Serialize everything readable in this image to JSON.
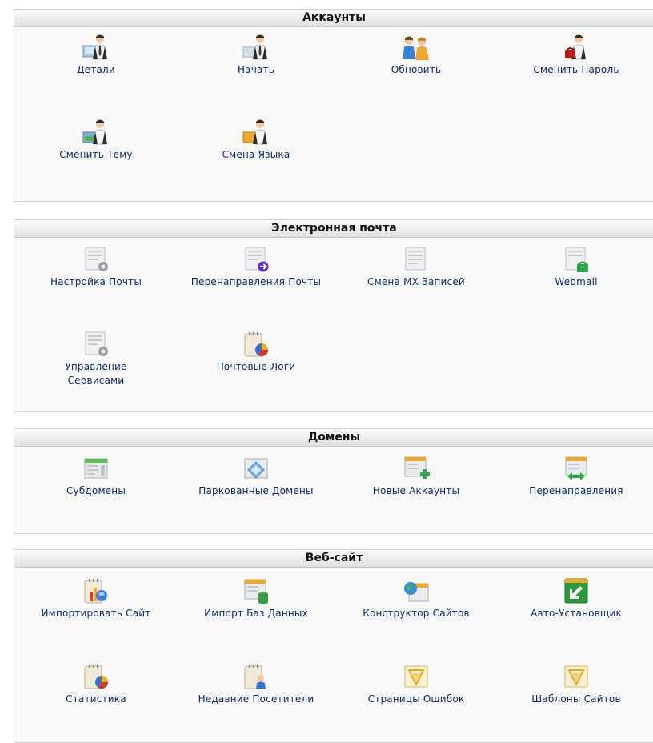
{
  "sections": [
    {
      "title": "Аккаунты",
      "items": [
        {
          "label": "Детали",
          "icon": "user-details-icon"
        },
        {
          "label": "Начать",
          "icon": "user-start-icon"
        },
        {
          "label": "Обновить",
          "icon": "users-update-icon"
        },
        {
          "label": "Сменить Пароль",
          "icon": "user-password-icon"
        },
        {
          "label": "Сменить Тему",
          "icon": "user-theme-icon"
        },
        {
          "label": "Смена Языка",
          "icon": "user-language-icon"
        }
      ]
    },
    {
      "title": "Электронная почта",
      "items": [
        {
          "label": "Настройка Почты",
          "icon": "mail-settings-icon"
        },
        {
          "label": "Перенаправления Почты",
          "icon": "mail-forward-icon"
        },
        {
          "label": "Смена MX Записей",
          "icon": "mx-records-icon"
        },
        {
          "label": "Webmail",
          "icon": "webmail-icon"
        },
        {
          "label": "Управление Сервисами",
          "icon": "services-icon"
        },
        {
          "label": "Почтовые Логи",
          "icon": "mail-logs-icon"
        }
      ]
    },
    {
      "title": "Домены",
      "items": [
        {
          "label": "Субдомены",
          "icon": "subdomains-icon"
        },
        {
          "label": "Паркованные Домены",
          "icon": "parked-domains-icon"
        },
        {
          "label": "Новые Аккаунты",
          "icon": "new-accounts-icon"
        },
        {
          "label": "Перенаправления",
          "icon": "redirects-icon"
        }
      ]
    },
    {
      "title": "Веб-сайт",
      "items": [
        {
          "label": "Импортировать Сайт",
          "icon": "import-site-icon"
        },
        {
          "label": "Импорт Баз Данных",
          "icon": "import-db-icon"
        },
        {
          "label": "Конструктор Сайтов",
          "icon": "site-builder-icon"
        },
        {
          "label": "Авто-Установщик",
          "icon": "auto-installer-icon"
        },
        {
          "label": "Статистика",
          "icon": "statistics-icon"
        },
        {
          "label": "Недавние Посетители",
          "icon": "recent-visitors-icon"
        },
        {
          "label": "Страницы Ошибок",
          "icon": "error-pages-icon"
        },
        {
          "label": "Шаблоны Сайтов",
          "icon": "site-templates-icon"
        }
      ]
    }
  ]
}
